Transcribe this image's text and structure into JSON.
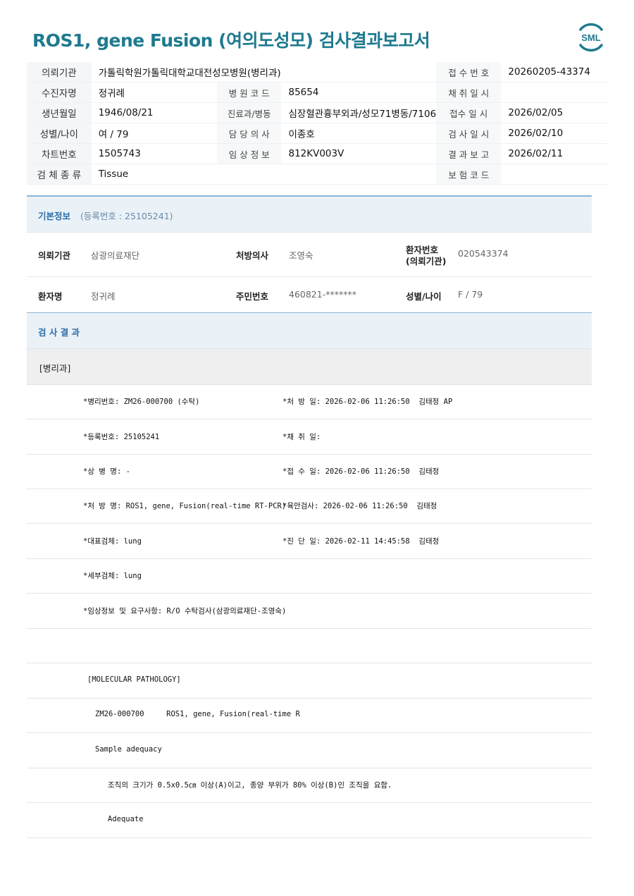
{
  "header": {
    "title": "ROS1, gene Fusion (여의도성모) 검사결과보고서",
    "logo_text": "SML"
  },
  "top_info": [
    [
      "의뢰기관",
      "가톨릭학원가톨릭대학교대전성모병원(병리과)",
      "",
      "",
      "접 수 번 호",
      "20260205-43374"
    ],
    [
      "수진자명",
      "정귀례",
      "병 원 코 드",
      "85654",
      "채 취 일 시",
      ""
    ],
    [
      "생년월일",
      "1946/08/21",
      "진료과/병동",
      "심장혈관흉부외과/성모71병동/7106",
      "접수 일 시",
      "2026/02/05"
    ],
    [
      "성별/나이",
      "여 / 79",
      "담 당 의 사",
      "이종호",
      "검 사 일 시",
      "2026/02/10"
    ],
    [
      "차트번호",
      "1505743",
      "임 상 정 보",
      "812KV003V",
      "결 과 보 고",
      "2026/02/11"
    ],
    [
      "검 체 종 류",
      "Tissue",
      "",
      "",
      "보 험 코 드",
      ""
    ]
  ],
  "basic": {
    "title": "기본정보",
    "reg": "(등록번호 : 25105241)",
    "org_label": "의뢰기관",
    "org_value": "삼광의료재단",
    "doctor_label": "처방의사",
    "doctor_value": "조영숙",
    "ptno_label_1": "환자번호",
    "ptno_label_2": "(의뢰기관)",
    "ptno_value": "020543374",
    "name_label": "환자명",
    "name_value": "정귀례",
    "rrn_label": "주민번호",
    "rrn_value": "460821-*******",
    "sexage_label": "성별/나이",
    "sexage_value": "F / 79"
  },
  "result": {
    "title": "검 사 결 과",
    "dept": "[병리과]",
    "rows": [
      [
        "*병리번호: ZM26-000700 (수탁)",
        "*처 방 일: 2026-02-06 11:26:50  김태정 AP"
      ],
      [
        "*등록번호: 25105241",
        "*채 취 일:"
      ],
      [
        "*상 병 명: -",
        "*접 수 일: 2026-02-06 11:26:50  김태정"
      ],
      [
        "*처 방 명: ROS1, gene, Fusion(real-time RT-PCR)",
        "*육안검사: 2026-02-06 11:26:50  김태정"
      ],
      [
        "*대표검체: lung",
        "*진 단 일: 2026-02-11 14:45:58  김태정"
      ],
      [
        "*세부검체: lung",
        ""
      ],
      [
        "*임상정보 및 요구사항: R/O 수탁검사(삼광의료재단-조영숙)",
        ""
      ]
    ],
    "molecular": "[MOLECULAR PATHOLOGY]",
    "code_line": "ZM26-000700     ROS1, gene, Fusion(real-time R",
    "sample_adequacy": "Sample adequacy",
    "criteria": "조직의 크기가 0.5x0.5㎝ 이상(A)이고, 종양 부위가 80% 이상(B)인 조직을 요함.",
    "adequate": "Adequate"
  }
}
